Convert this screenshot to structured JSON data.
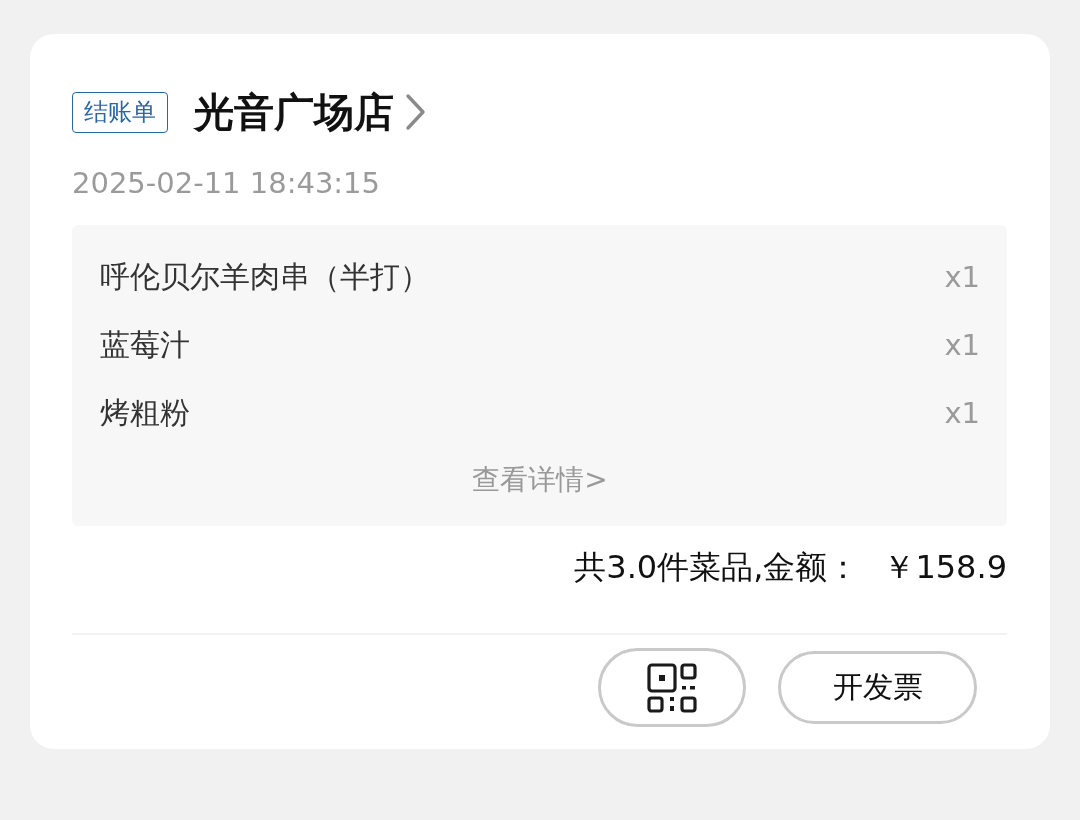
{
  "header": {
    "badge": "结账单",
    "store_name": "光音广场店"
  },
  "timestamp": "2025-02-11 18:43:15",
  "items": [
    {
      "name": "呼伦贝尔羊肉串（半打）",
      "quantity": "x1"
    },
    {
      "name": "蓝莓汁",
      "quantity": "x1"
    },
    {
      "name": "烤粗粉",
      "quantity": "x1"
    }
  ],
  "details_link": "查看详情>",
  "summary": {
    "label": "共3.0件菜品,金额：",
    "amount": "￥158.9"
  },
  "buttons": [
    {
      "kind": "qr"
    },
    {
      "kind": "text",
      "label": "开发票"
    }
  ]
}
